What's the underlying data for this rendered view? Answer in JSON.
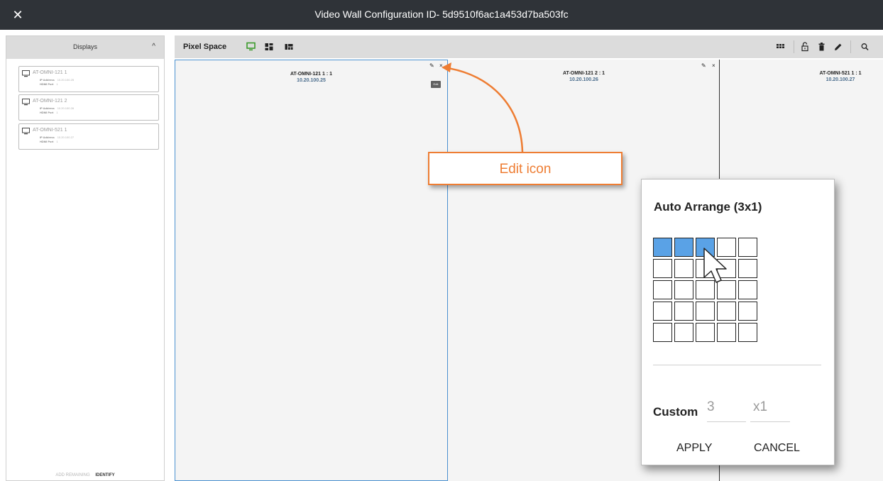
{
  "window": {
    "title": "Video Wall Configuration ID- 5d9510f6ac1a453d7ba503fc",
    "close_glyph": "✕"
  },
  "sidebar": {
    "header": "Displays",
    "collapse_glyph": "^",
    "displays": [
      {
        "name": "AT-OMNI-121 1",
        "ip_label": "IP Address",
        "ip": "10.20.100.25",
        "port_label": "HDMI Port",
        "port": "1"
      },
      {
        "name": "AT-OMNI-121 2",
        "ip_label": "IP Address",
        "ip": "10.20.100.26",
        "port_label": "HDMI Port",
        "port": "1"
      },
      {
        "name": "AT-OMNI-521 1",
        "ip_label": "IP Address",
        "ip": "10.20.100.27",
        "port_label": "HDMI Port",
        "port": "1"
      }
    ],
    "add_remaining": "ADD REMAINING",
    "identify": "IDENTIFY"
  },
  "toolbar": {
    "title": "Pixel Space",
    "accent_color": "#3a9a2a"
  },
  "panels": [
    {
      "name": "AT-OMNI-121 1 : 1",
      "ip": "10.20.100.25"
    },
    {
      "name": "AT-OMNI-121 2 : 1",
      "ip": "10.20.100.26"
    },
    {
      "name": "AT-OMNI-521 1 : 1",
      "ip": "10.20.100.27"
    }
  ],
  "panel_controls": {
    "edit_glyph": "✎",
    "close_glyph": "×"
  },
  "tooltip": "Edit",
  "callout": {
    "text": "Edit icon",
    "color": "#ee7d33"
  },
  "auto_arrange": {
    "title": "Auto Arrange (3x1)",
    "grid_cols": 5,
    "grid_rows": 5,
    "selected_cols": 3,
    "selected_rows": 1,
    "selected_color": "#5aa2e6",
    "custom_label": "Custom",
    "custom_cols": "3",
    "custom_rows": "x1",
    "apply": "APPLY",
    "cancel": "CANCEL"
  }
}
